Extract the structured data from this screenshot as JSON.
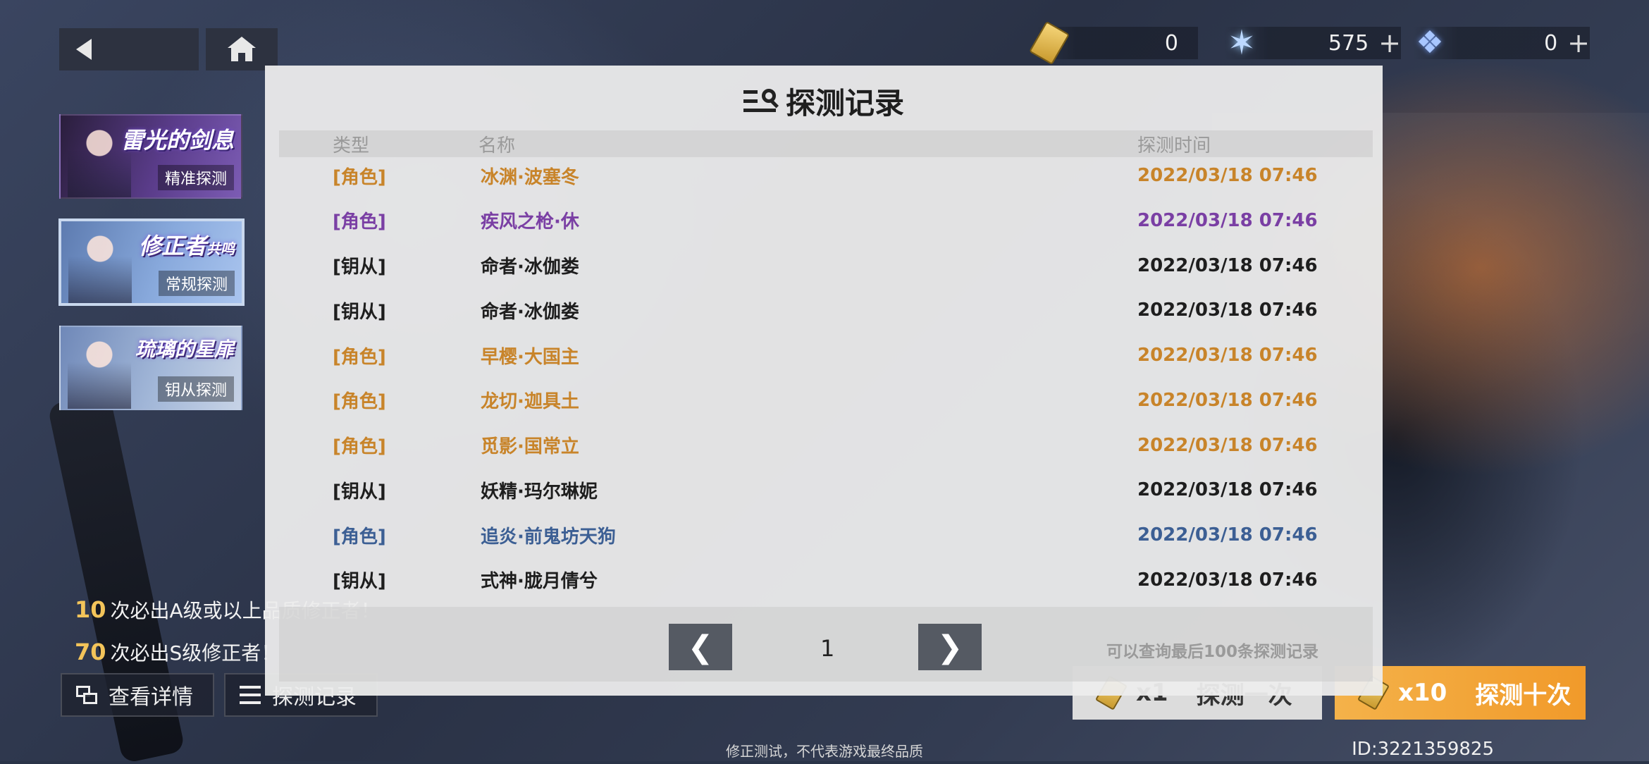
{
  "currency": [
    {
      "icon": "ticket-icon",
      "value": "0",
      "has_plus": false
    },
    {
      "icon": "star-crystal-icon",
      "value": "575",
      "has_plus": true
    },
    {
      "icon": "blue-crystal-icon",
      "value": "0",
      "has_plus": true
    }
  ],
  "banners": [
    {
      "title": "雷光的剑息",
      "subtitle": "精准探测"
    },
    {
      "title": "修正者",
      "title_small": "共鸣",
      "subtitle": "常规探测"
    },
    {
      "title": "琉璃的星扉",
      "subtitle": "钥从探测"
    }
  ],
  "info": {
    "line1_num": "10",
    "line1_text": "次必出A级或以上品质修正者！",
    "line2_num": "70",
    "line2_text": "次必出S级修正者！"
  },
  "buttons": {
    "details": "查看详情",
    "records": "探测记录",
    "draw_one_mult": "x1",
    "draw_one": "探测一次",
    "draw_ten_mult": "x10",
    "draw_ten": "探测十次"
  },
  "modal": {
    "title": "探测记录",
    "headers": {
      "type": "类型",
      "name": "名称",
      "time": "探测时间"
    },
    "rows": [
      {
        "type": "[角色]",
        "name": "冰渊·波塞冬",
        "time": "2022/03/18 07:46",
        "color": "#c8842a"
      },
      {
        "type": "[角色]",
        "name": "疾风之枪·休",
        "time": "2022/03/18 07:46",
        "color": "#7a3fa4"
      },
      {
        "type": "[钥从]",
        "name": "命者·冰伽娄",
        "time": "2022/03/18 07:46",
        "color": "#1e1e1e"
      },
      {
        "type": "[钥从]",
        "name": "命者·冰伽娄",
        "time": "2022/03/18 07:46",
        "color": "#1e1e1e"
      },
      {
        "type": "[角色]",
        "name": "早樱·大国主",
        "time": "2022/03/18 07:46",
        "color": "#c8842a"
      },
      {
        "type": "[角色]",
        "name": "龙切·迦具土",
        "time": "2022/03/18 07:46",
        "color": "#c8842a"
      },
      {
        "type": "[角色]",
        "name": "觅影·国常立",
        "time": "2022/03/18 07:46",
        "color": "#c8842a"
      },
      {
        "type": "[钥从]",
        "name": "妖精·玛尔琳妮",
        "time": "2022/03/18 07:46",
        "color": "#1e1e1e"
      },
      {
        "type": "[角色]",
        "name": "追炎·前鬼坊天狗",
        "time": "2022/03/18 07:46",
        "color": "#3c5f94"
      },
      {
        "type": "[钥从]",
        "name": "式神·胧月倩兮",
        "time": "2022/03/18 07:46",
        "color": "#1e1e1e"
      }
    ],
    "page": "1",
    "prev": "❮",
    "next": "❯",
    "note": "可以查询最后100条探测记录"
  },
  "footer_note": "修正测试，不代表游戏最终品质",
  "player_id": "ID:3221359825"
}
